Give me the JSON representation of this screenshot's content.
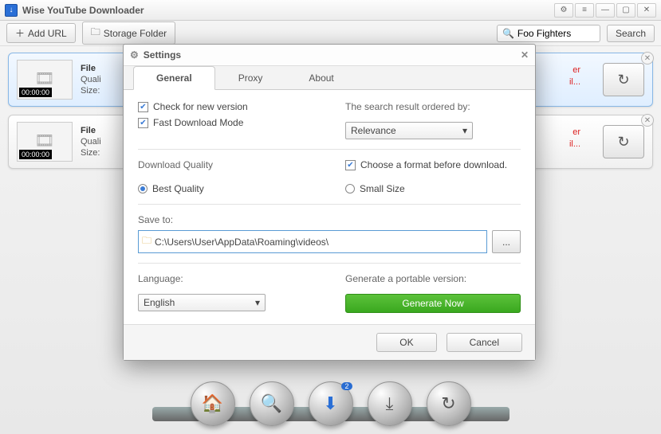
{
  "app": {
    "title": "Wise YouTube Downloader"
  },
  "toolbar": {
    "add_url": "Add URL",
    "storage_folder": "Storage Folder",
    "search_value": "Foo Fighters",
    "search_btn": "Search"
  },
  "cards": [
    {
      "file": "File",
      "quality": "Quali",
      "size": "Size:",
      "time": "00:00:00",
      "link1": "er",
      "link2": "il..."
    },
    {
      "file": "File",
      "quality": "Quali",
      "size": "Size:",
      "time": "00:00:00",
      "link1": "er",
      "link2": "il..."
    }
  ],
  "dock": {
    "badge": "2"
  },
  "settings": {
    "title": "Settings",
    "tabs": {
      "general": "General",
      "proxy": "Proxy",
      "about": "About"
    },
    "check_version": "Check for new version",
    "fast_mode": "Fast Download Mode",
    "order_label": "The search result ordered by:",
    "order_value": "Relevance",
    "dl_quality": "Download Quality",
    "choose_format": "Choose a format before download.",
    "best_quality": "Best Quality",
    "small_size": "Small Size",
    "save_to": "Save to:",
    "path": "C:\\Users\\User\\AppData\\Roaming\\videos\\",
    "browse": "...",
    "language": "Language:",
    "language_value": "English",
    "portable": "Generate a portable version:",
    "generate": "Generate Now",
    "ok": "OK",
    "cancel": "Cancel"
  }
}
